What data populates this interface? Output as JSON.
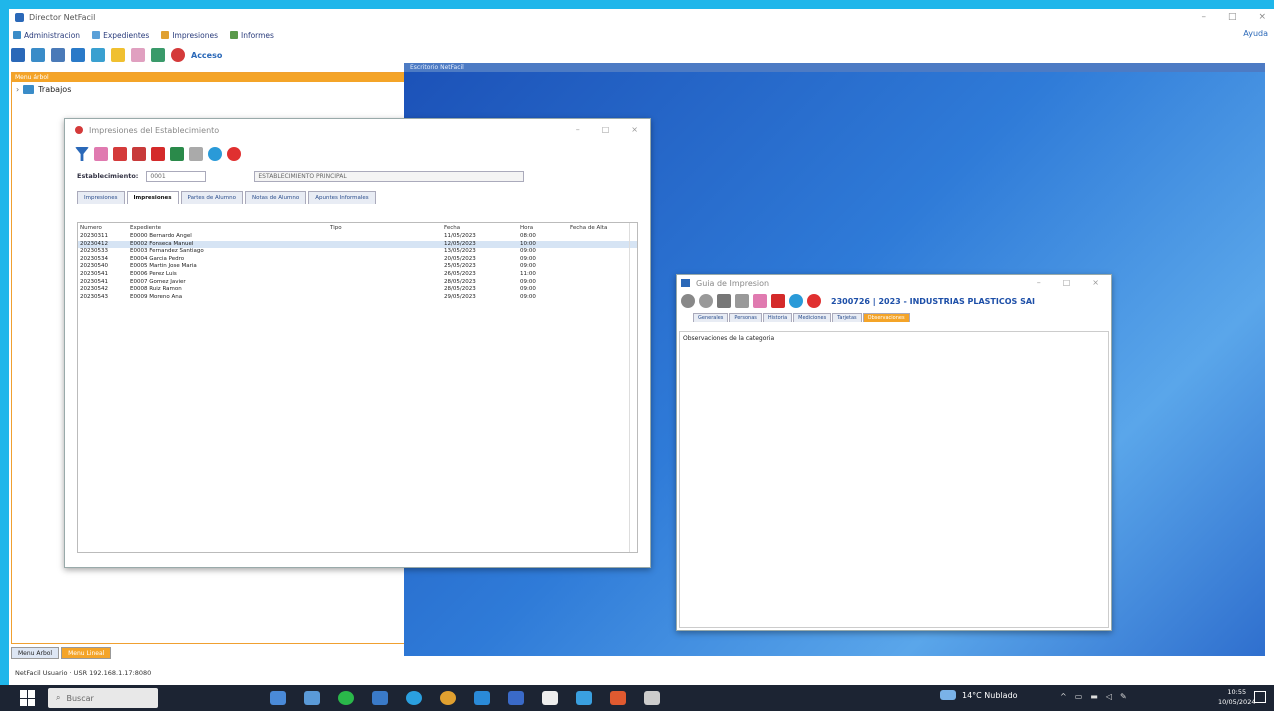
{
  "app": {
    "title": "Director NetFacil",
    "menu": [
      "Administracion",
      "Expedientes",
      "Impresiones",
      "Informes"
    ],
    "menu_right": "Ayuda",
    "toolbar_text": "Acceso"
  },
  "left_pane": {
    "header": "Menu árbol",
    "tree_item": "Trabajos"
  },
  "desktop_header": "Escritorio NetFacil",
  "bottom_tabs": [
    "Menu Arbol",
    "Menu Lineal"
  ],
  "status": "NetFacil   Usuario · USR   192.168.1.17:8080",
  "dialog1": {
    "title": "Impresiones del Establecimiento",
    "field_label": "Establecimiento:",
    "field_code": "0001",
    "field_name": "ESTABLECIMIENTO PRINCIPAL",
    "tabs": [
      "Impresiones",
      "Impresiones",
      "Partes de Alumno",
      "Notas de Alumno",
      "Apuntes Informales"
    ],
    "columns": [
      "Numero",
      "Expediente",
      "Tipo",
      "Fecha",
      "Hora",
      "Fecha de Alta"
    ],
    "rows": [
      {
        "n": "20230311",
        "e": "E0000 Bernardo Angel",
        "t": "",
        "f": "11/05/2023",
        "h": "08:00"
      },
      {
        "n": "20230412",
        "e": "E0002 Fonseca Manuel",
        "t": "",
        "f": "12/05/2023",
        "h": "10:00"
      },
      {
        "n": "20230533",
        "e": "E0003 Fernandez Santiago",
        "t": "",
        "f": "13/05/2023",
        "h": "09:00"
      },
      {
        "n": "20230534",
        "e": "E0004 Garcia Pedro",
        "t": "",
        "f": "20/05/2023",
        "h": "09:00"
      },
      {
        "n": "20230540",
        "e": "E0005 Martin Jose Maria",
        "t": "",
        "f": "25/05/2023",
        "h": "09:00"
      },
      {
        "n": "20230541",
        "e": "E0006 Perez Luis",
        "t": "",
        "f": "26/05/2023",
        "h": "11:00"
      },
      {
        "n": "20230541",
        "e": "E0007 Gomez Javier",
        "t": "",
        "f": "28/05/2023",
        "h": "09:00"
      },
      {
        "n": "20230542",
        "e": "E0008 Ruiz Ramon",
        "t": "",
        "f": "28/05/2023",
        "h": "09:00"
      },
      {
        "n": "20230543",
        "e": "E0009 Moreno Ana",
        "t": "",
        "f": "29/05/2023",
        "h": "09:00"
      }
    ]
  },
  "dialog2": {
    "title": "Guia de Impresion",
    "heading": "2300726 | 2023 - INDUSTRIAS PLASTICOS SAI",
    "tabs": [
      "Generales",
      "Personas",
      "Historia",
      "Mediciones",
      "Tarjetas",
      "Observaciones"
    ],
    "body": "Observaciones de la categoria"
  },
  "taskbar": {
    "search": "Buscar",
    "weather": "14°C Nublado",
    "time": "10:55",
    "date": "10/05/2024"
  }
}
